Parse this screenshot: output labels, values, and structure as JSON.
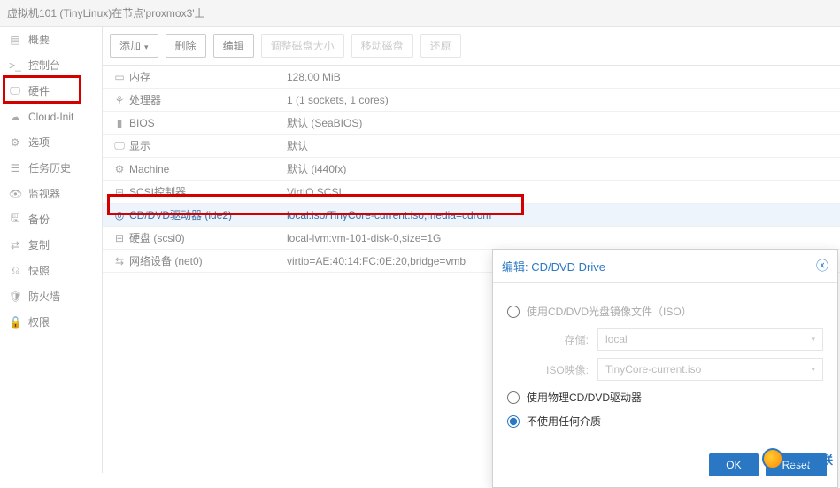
{
  "titlebar": "虚拟机101 (TinyLinux)在节点'proxmox3'上",
  "sidebar": {
    "items": [
      {
        "icon": "▤",
        "label": "概要"
      },
      {
        "icon": ">_",
        "label": "控制台"
      },
      {
        "icon": "🖵",
        "label": "硬件"
      },
      {
        "icon": "☁",
        "label": "Cloud-Init"
      },
      {
        "icon": "⚙",
        "label": "选项"
      },
      {
        "icon": "☰",
        "label": "任务历史"
      },
      {
        "icon": "👁",
        "label": "监视器"
      },
      {
        "icon": "🖫",
        "label": "备份"
      },
      {
        "icon": "⇄",
        "label": "复制"
      },
      {
        "icon": "⎌",
        "label": "快照"
      },
      {
        "icon": "🛡",
        "label": "防火墙"
      },
      {
        "icon": "🔓",
        "label": "权限"
      }
    ]
  },
  "toolbar": {
    "add": "添加",
    "remove": "删除",
    "edit": "编辑",
    "resize": "调整磁盘大小",
    "move": "移动磁盘",
    "revert": "还原"
  },
  "hardware": [
    {
      "icon": "▭",
      "name": "内存",
      "value": "128.00 MiB"
    },
    {
      "icon": "⚘",
      "name": "处理器",
      "value": "1 (1 sockets, 1 cores)"
    },
    {
      "icon": "▮",
      "name": "BIOS",
      "value": "默认 (SeaBIOS)"
    },
    {
      "icon": "🖵",
      "name": "显示",
      "value": "默认"
    },
    {
      "icon": "⚙",
      "name": "Machine",
      "value": "默认 (i440fx)"
    },
    {
      "icon": "⊟",
      "name": "SCSI控制器",
      "value": "VirtIO SCSI"
    },
    {
      "icon": "◎",
      "name": "CD/DVD驱动器 (ide2)",
      "value": "local:iso/TinyCore-current.iso,media=cdrom",
      "selected": true
    },
    {
      "icon": "⊟",
      "name": "硬盘 (scsi0)",
      "value": "local-lvm:vm-101-disk-0,size=1G"
    },
    {
      "icon": "⇆",
      "name": "网络设备 (net0)",
      "value": "virtio=AE:40:14:FC:0E:20,bridge=vmb"
    }
  ],
  "dialog": {
    "title": "编辑: CD/DVD Drive",
    "opt_iso": "使用CD/DVD光盘镜像文件（ISO）",
    "storage_label": "存储:",
    "storage_value": "local",
    "iso_label": "ISO映像:",
    "iso_value": "TinyCore-current.iso",
    "opt_physical": "使用物理CD/DVD驱动器",
    "opt_none": "不使用任何介质",
    "ok": "OK",
    "reset": "Reset"
  },
  "footer_brand": "创新互联"
}
